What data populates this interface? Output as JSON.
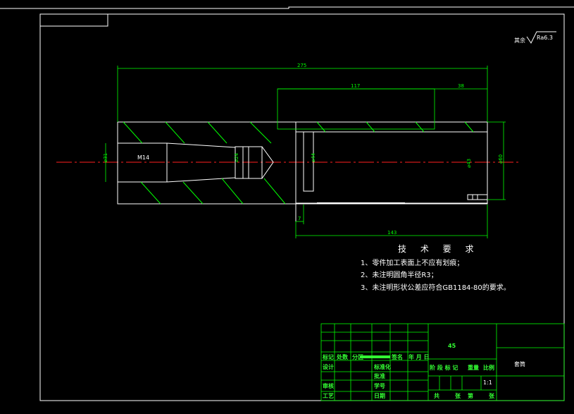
{
  "roughness": {
    "prefix": "其余",
    "value": "Ra6.3"
  },
  "dimensions": {
    "overall_length": "275",
    "bore_length": "117",
    "bore_end": "38",
    "lower_length": "143",
    "small_step": "7",
    "d_left": "⌀31",
    "thread": "M14",
    "d_taper": "⌀24",
    "d_bore_left": "⌀44",
    "d_bore_right": "⌀43",
    "d_outer": "⌀60"
  },
  "technical_requirements": {
    "title": "技 术 要 求",
    "items": [
      "1、零件加工表面上不应有划痕；",
      "2、未注明圆角半径R3；",
      "3、未注明形状公差应符合GB1184-80的要求。"
    ]
  },
  "title_block": {
    "material": "45",
    "part_name": "套筒",
    "header_row": [
      "标记",
      "处数",
      "分区",
      "",
      "签名",
      "年 月 日"
    ],
    "left_labels": [
      "设计",
      "审核",
      "工艺"
    ],
    "middle_labels": [
      "标准化",
      "批准",
      "学号",
      "日期"
    ],
    "stage_labels": [
      "阶 段 标 记",
      "重量",
      "比例"
    ],
    "scale": "1:1",
    "sheet_labels": [
      "共",
      "张",
      "第",
      "张"
    ]
  },
  "colors": {
    "frame": "#ffffff",
    "part_outline": "#ffffff",
    "dimension": "#00ff00",
    "centerline": "#ff2020",
    "table": "#00ff00"
  }
}
